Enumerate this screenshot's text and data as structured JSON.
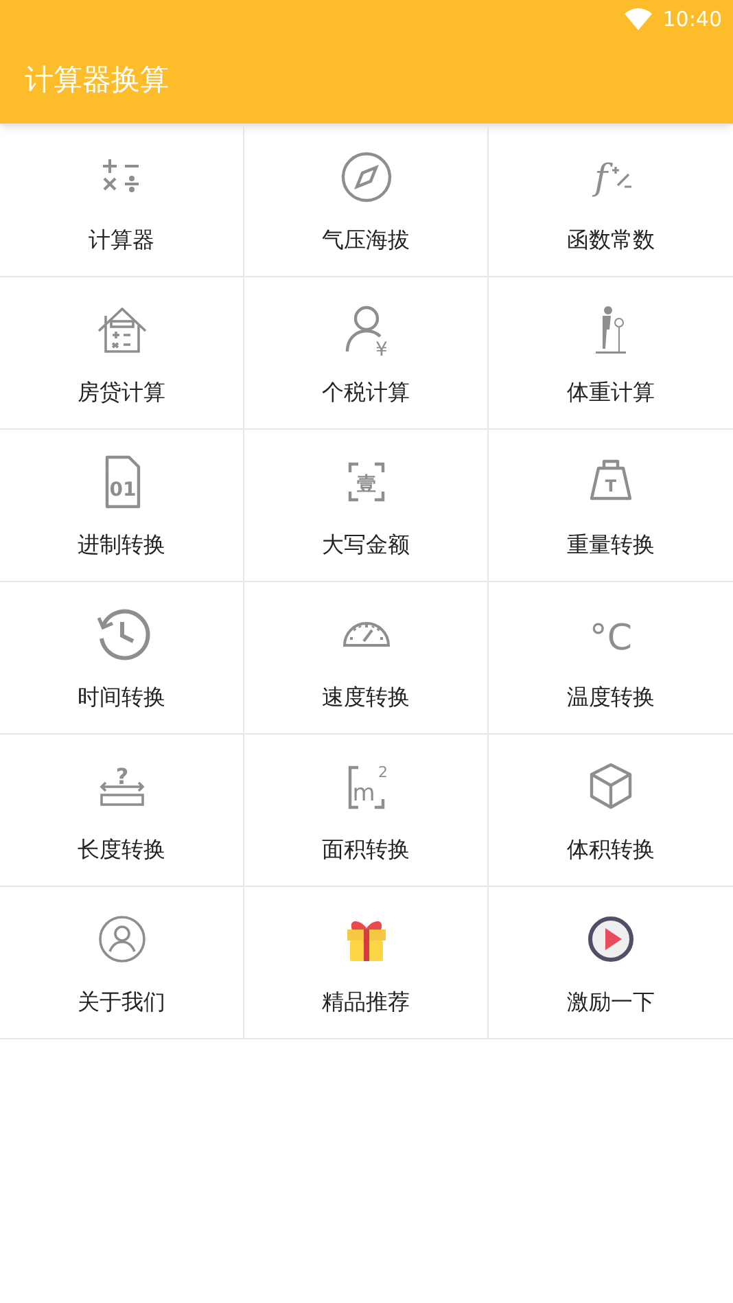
{
  "status_bar": {
    "time": "10:40"
  },
  "app_bar": {
    "title": "计算器换算"
  },
  "grid": [
    {
      "label": "计算器"
    },
    {
      "label": "气压海拔"
    },
    {
      "label": "函数常数",
      "icon_text": "f"
    },
    {
      "label": "房贷计算"
    },
    {
      "label": "个税计算",
      "icon_text": "¥"
    },
    {
      "label": "体重计算"
    },
    {
      "label": "进制转换",
      "icon_text": "01"
    },
    {
      "label": "大写金额",
      "icon_text": "壹"
    },
    {
      "label": "重量转换",
      "icon_text": "T"
    },
    {
      "label": "时间转换"
    },
    {
      "label": "速度转换"
    },
    {
      "label": "温度转换",
      "icon_text": "°C"
    },
    {
      "label": "长度转换",
      "icon_text": "?"
    },
    {
      "label": "面积转换",
      "icon_text": "m",
      "icon_sup": "2"
    },
    {
      "label": "体积转换"
    },
    {
      "label": "关于我们"
    },
    {
      "label": "精品推荐"
    },
    {
      "label": "激励一下"
    }
  ]
}
